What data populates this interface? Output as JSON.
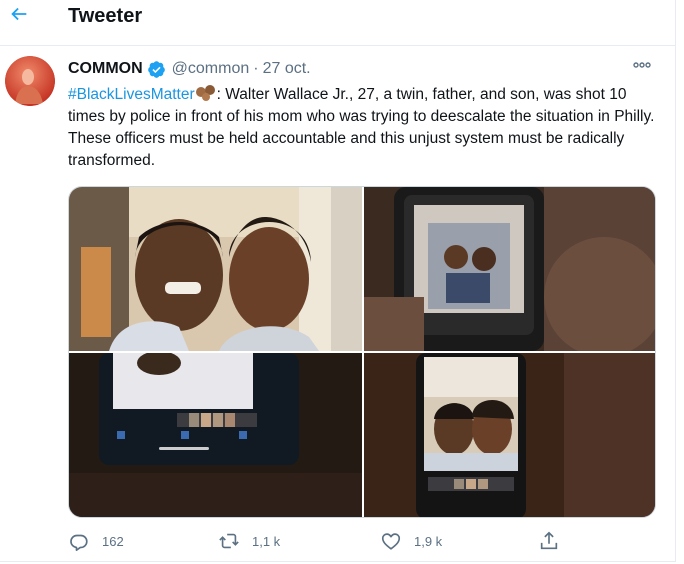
{
  "header": {
    "title": "Tweeter",
    "back_icon": "back-arrow-icon"
  },
  "tweet": {
    "author_name": "COMMON",
    "handle": "@common",
    "separator": "·",
    "date": "27 oct.",
    "verified_icon": "verified-badge-icon",
    "hashtag": "#BlackLivesMatter",
    "emoji_icon": "fist-emoji-icon",
    "body": ": Walter Wallace Jr., 27, a twin, father, and son, was shot 10 times by police in front of his mom who was trying to deescalate the situation in Philly. These officers must be held accountable and this unjust system must be radically transformed."
  },
  "actions": {
    "reply_count": "162",
    "retweet_count": "1,1 k",
    "like_count": "1,9 k"
  },
  "colors": {
    "accent": "#1da1f2",
    "hashtag": "#1b95e0",
    "secondary_text": "#5b7083",
    "border": "#e6ecf0"
  }
}
